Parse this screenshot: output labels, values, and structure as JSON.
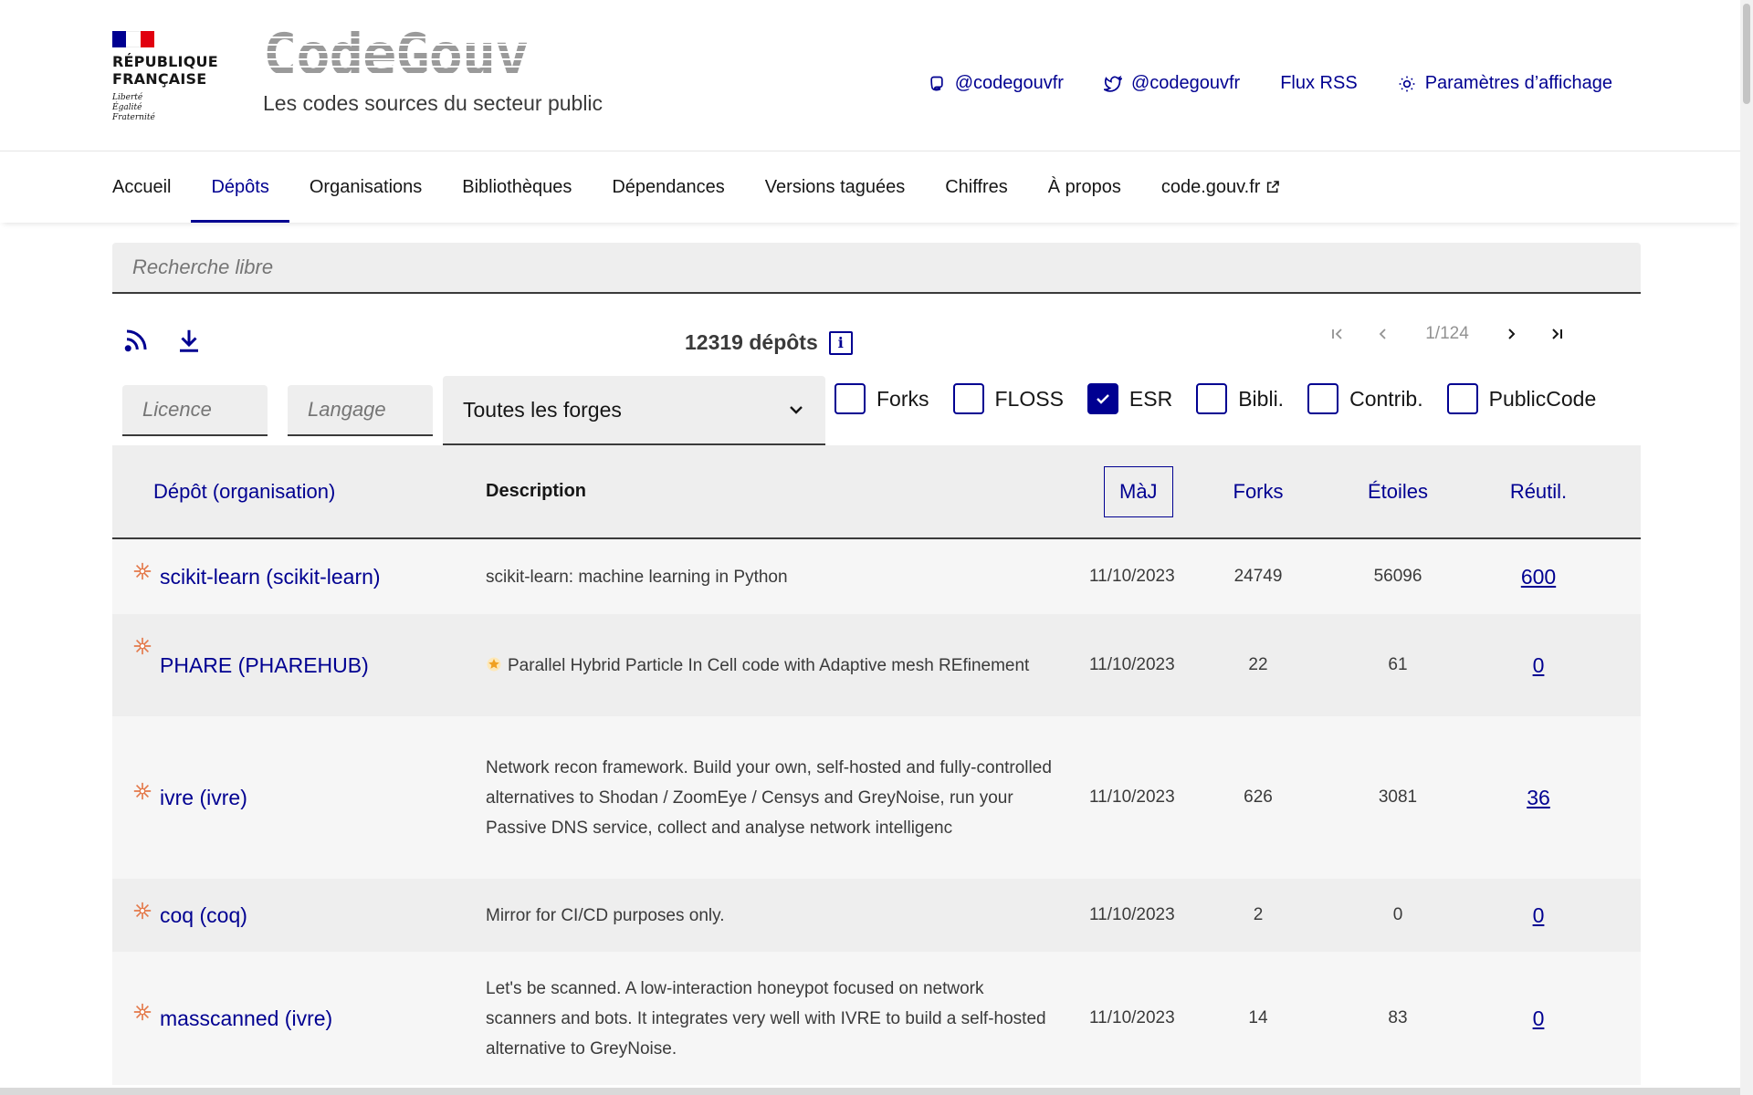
{
  "header": {
    "marianne_lines": [
      "RÉPUBLIQUE",
      "FRANÇAISE"
    ],
    "motto": [
      "Liberté",
      "Égalité",
      "Fraternité"
    ],
    "brand_title": "CodeGouv",
    "brand_subtitle": "Les codes sources du secteur public",
    "quick_links": [
      {
        "icon": "mastodon-icon",
        "label": "@codegouvfr"
      },
      {
        "icon": "twitter-icon",
        "label": "@codegouvfr"
      },
      {
        "icon": "",
        "label": "Flux RSS"
      },
      {
        "icon": "sun-icon",
        "label": "Paramètres d’affichage"
      }
    ]
  },
  "nav": {
    "items": [
      "Accueil",
      "Dépôts",
      "Organisations",
      "Bibliothèques",
      "Dépendances",
      "Versions taguées",
      "Chiffres",
      "À propos",
      "code.gouv.fr"
    ],
    "active_index": 1
  },
  "search": {
    "placeholder": "Recherche libre"
  },
  "toolbar": {
    "count_label": "12319 dépôts",
    "info_glyph": "i",
    "page_indicator": "1/124"
  },
  "filters": {
    "license_placeholder": "Licence",
    "language_placeholder": "Langage",
    "forge_selected": "Toutes les forges",
    "checkboxes": [
      {
        "label": "Forks",
        "checked": false
      },
      {
        "label": "FLOSS",
        "checked": false
      },
      {
        "label": "ESR",
        "checked": true
      },
      {
        "label": "Bibli.",
        "checked": false
      },
      {
        "label": "Contrib.",
        "checked": false
      },
      {
        "label": "PublicCode",
        "checked": false
      }
    ]
  },
  "table": {
    "headers": {
      "repo": "Dépôt (organisation)",
      "description": "Description",
      "updated": "MàJ",
      "forks": "Forks",
      "stars": "Étoiles",
      "reuse": "Réutil."
    },
    "rows": [
      {
        "name": "scikit-learn",
        "org": "scikit-learn",
        "description": "scikit-learn: machine learning in Python",
        "updated": "11/10/2023",
        "forks": "24749",
        "stars": "56096",
        "reuse": "600",
        "starred": false
      },
      {
        "name": "PHARE",
        "org": "PHAREHUB",
        "description": "Parallel Hybrid Particle In Cell code with Adaptive mesh REfinement",
        "updated": "11/10/2023",
        "forks": "22",
        "stars": "61",
        "reuse": "0",
        "starred": true
      },
      {
        "name": "ivre",
        "org": "ivre",
        "description": "Network recon framework. Build your own, self-hosted and fully-controlled alternatives to Shodan / ZoomEye / Censys and GreyNoise, run your Passive DNS service, collect and analyse network intelligenc",
        "updated": "11/10/2023",
        "forks": "626",
        "stars": "3081",
        "reuse": "36",
        "starred": false
      },
      {
        "name": "coq",
        "org": "coq",
        "description": "Mirror for CI/CD purposes only.",
        "updated": "11/10/2023",
        "forks": "2",
        "stars": "0",
        "reuse": "0",
        "starred": false
      },
      {
        "name": "masscanned",
        "org": "ivre",
        "description": "Let's be scanned. A low-interaction honeypot focused on network scanners and bots. It integrates very well with IVRE to build a self-hosted alternative to GreyNoise.",
        "updated": "11/10/2023",
        "forks": "14",
        "stars": "83",
        "reuse": "0",
        "starred": false
      }
    ]
  },
  "colors": {
    "accent": "#000091",
    "flag_red": "#e1000f",
    "row_light": "#f6f6f6",
    "row_dark": "#eeeeee",
    "esr_spark": "#e4794a"
  }
}
